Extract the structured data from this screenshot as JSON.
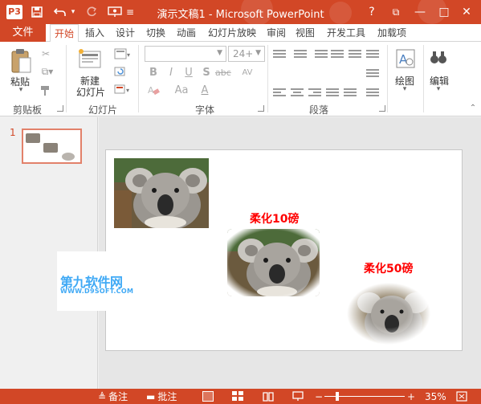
{
  "titlebar": {
    "app_icon": "P3",
    "title": "演示文稿1 - Microsoft PowerPoint",
    "help": "?",
    "restore": "⧉",
    "minimize": "—",
    "maximize": "□",
    "close": "✕",
    "qa_icons": [
      "save-icon",
      "undo-icon",
      "redo-icon",
      "presenter-icon"
    ]
  },
  "tabs": {
    "file": "文件",
    "items": [
      "开始",
      "插入",
      "设计",
      "切换",
      "动画",
      "幻灯片放映",
      "审阅",
      "视图",
      "开发工具",
      "加载项"
    ],
    "active": "开始"
  },
  "ribbon": {
    "clipboard": {
      "paste": "粘贴",
      "group": "剪贴板"
    },
    "slides": {
      "new_slide_line1": "新建",
      "new_slide_line2": "幻灯片",
      "group": "幻灯片"
    },
    "font": {
      "font_size": "24+",
      "bold": "B",
      "italic": "I",
      "underline": "U",
      "strike": "S",
      "shadow": "abc",
      "spacing": "AV",
      "case": "Aa",
      "color": "A",
      "group": "字体"
    },
    "paragraph": {
      "group": "段落"
    },
    "drawing": {
      "label": "绘图"
    },
    "editing": {
      "label": "编辑"
    }
  },
  "thumbnails": {
    "slide_number": "1"
  },
  "slide": {
    "label_10": "柔化10磅",
    "label_50": "柔化50磅"
  },
  "watermark": {
    "title": "第九软件网",
    "subtitle": "WWW.D9SOFT.COM"
  },
  "statusbar": {
    "notes": "备注",
    "comments": "批注",
    "zoom_minus": "−",
    "zoom_plus": "+",
    "zoom_percent": "35%",
    "zoom_level": 0.35
  },
  "colors": {
    "accent": "#d24726",
    "label_red": "#ff0000",
    "watermark_blue": "#3fa9f5"
  }
}
